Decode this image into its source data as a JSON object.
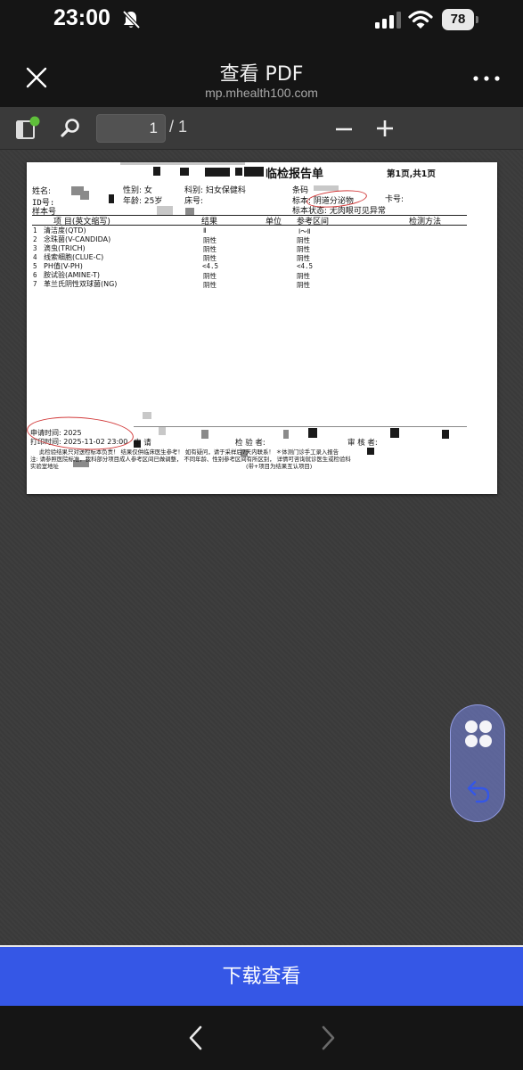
{
  "status_bar": {
    "time": "23:00",
    "battery": "78"
  },
  "header": {
    "title": "查看 PDF",
    "subtitle": "mp.mhealth100.com"
  },
  "toolbar": {
    "current_page": "1",
    "total_pages": "/ 1"
  },
  "document": {
    "title": "临检报告单",
    "page_info": "第1页,共1页",
    "fields": {
      "name_label": "姓名:",
      "gender": "性别: 女",
      "department": "科别:   妇女保健科",
      "barcode_label": "条码",
      "card_label": "卡号:",
      "id_label": "ID号:",
      "age": "年龄: 25岁",
      "bed_label": "床号:",
      "specimen": "标本: 阴道分泌物",
      "specimen_no_label": "样本号",
      "specimen_state": "标本状态: 无肉眼可见异常"
    },
    "table_headers": {
      "item": "项    目(英文缩写)",
      "result": "结果",
      "unit": "单位",
      "ref": "参考区间",
      "method": "检测方法"
    },
    "rows": [
      {
        "no": "1",
        "name": "清洁度(QTD)",
        "result": "Ⅱ",
        "ref": "Ⅰ～Ⅱ"
      },
      {
        "no": "2",
        "name": "念珠菌(V-CANDIDA)",
        "result": "阴性",
        "ref": "阴性"
      },
      {
        "no": "3",
        "name": "滴虫(TRICH)",
        "result": "阴性",
        "ref": "阴性"
      },
      {
        "no": "4",
        "name": "线索细胞(CLUE-C)",
        "result": "阴性",
        "ref": "阴性"
      },
      {
        "no": "5",
        "name": "PH值(V-PH)",
        "result": "<4.5",
        "ref": "<4.5"
      },
      {
        "no": "6",
        "name": "胺试验(AMINE-T)",
        "result": "阴性",
        "ref": "阴性"
      },
      {
        "no": "7",
        "name": "革兰氏阴性双球菌(NG)",
        "result": "阴性",
        "ref": "阴性"
      }
    ],
    "footer": {
      "request_time": "申请时间: 2025",
      "print_time": "打印时间: 2025-11-02 23:00",
      "applicant": "申 请",
      "tester": "检 验 者:",
      "reviewer": "审 核 者:",
      "note1": "此检验结果只对送检标本负责！ 结果仅供临床医生参考！ 如有疑问，请于采样后7天内联系！ ＊体测门诊手工录入报告",
      "note2": "注: 请参照医院标准，我科部分项目成人参考区间已做调整， 不同年龄、性别参考区间有所区别， 详情可咨询就诊医生或检验科",
      "lab_address": "实验室地址",
      "legend": "(带+项目为结果互认项目)"
    }
  },
  "download": {
    "label": "下载查看"
  },
  "icons": [
    "bell-slash-icon",
    "cellular-signal-icon",
    "wifi-icon",
    "battery-icon",
    "close-icon",
    "more-icon",
    "sidebar-toggle-icon",
    "search-icon",
    "minus-icon",
    "plus-icon",
    "apps-icon",
    "undo-icon",
    "chevron-left-icon",
    "chevron-right-icon"
  ],
  "colors": {
    "accent": "#3557e6",
    "annotation": "#d23a3a",
    "float_tool": "#7887e6"
  }
}
